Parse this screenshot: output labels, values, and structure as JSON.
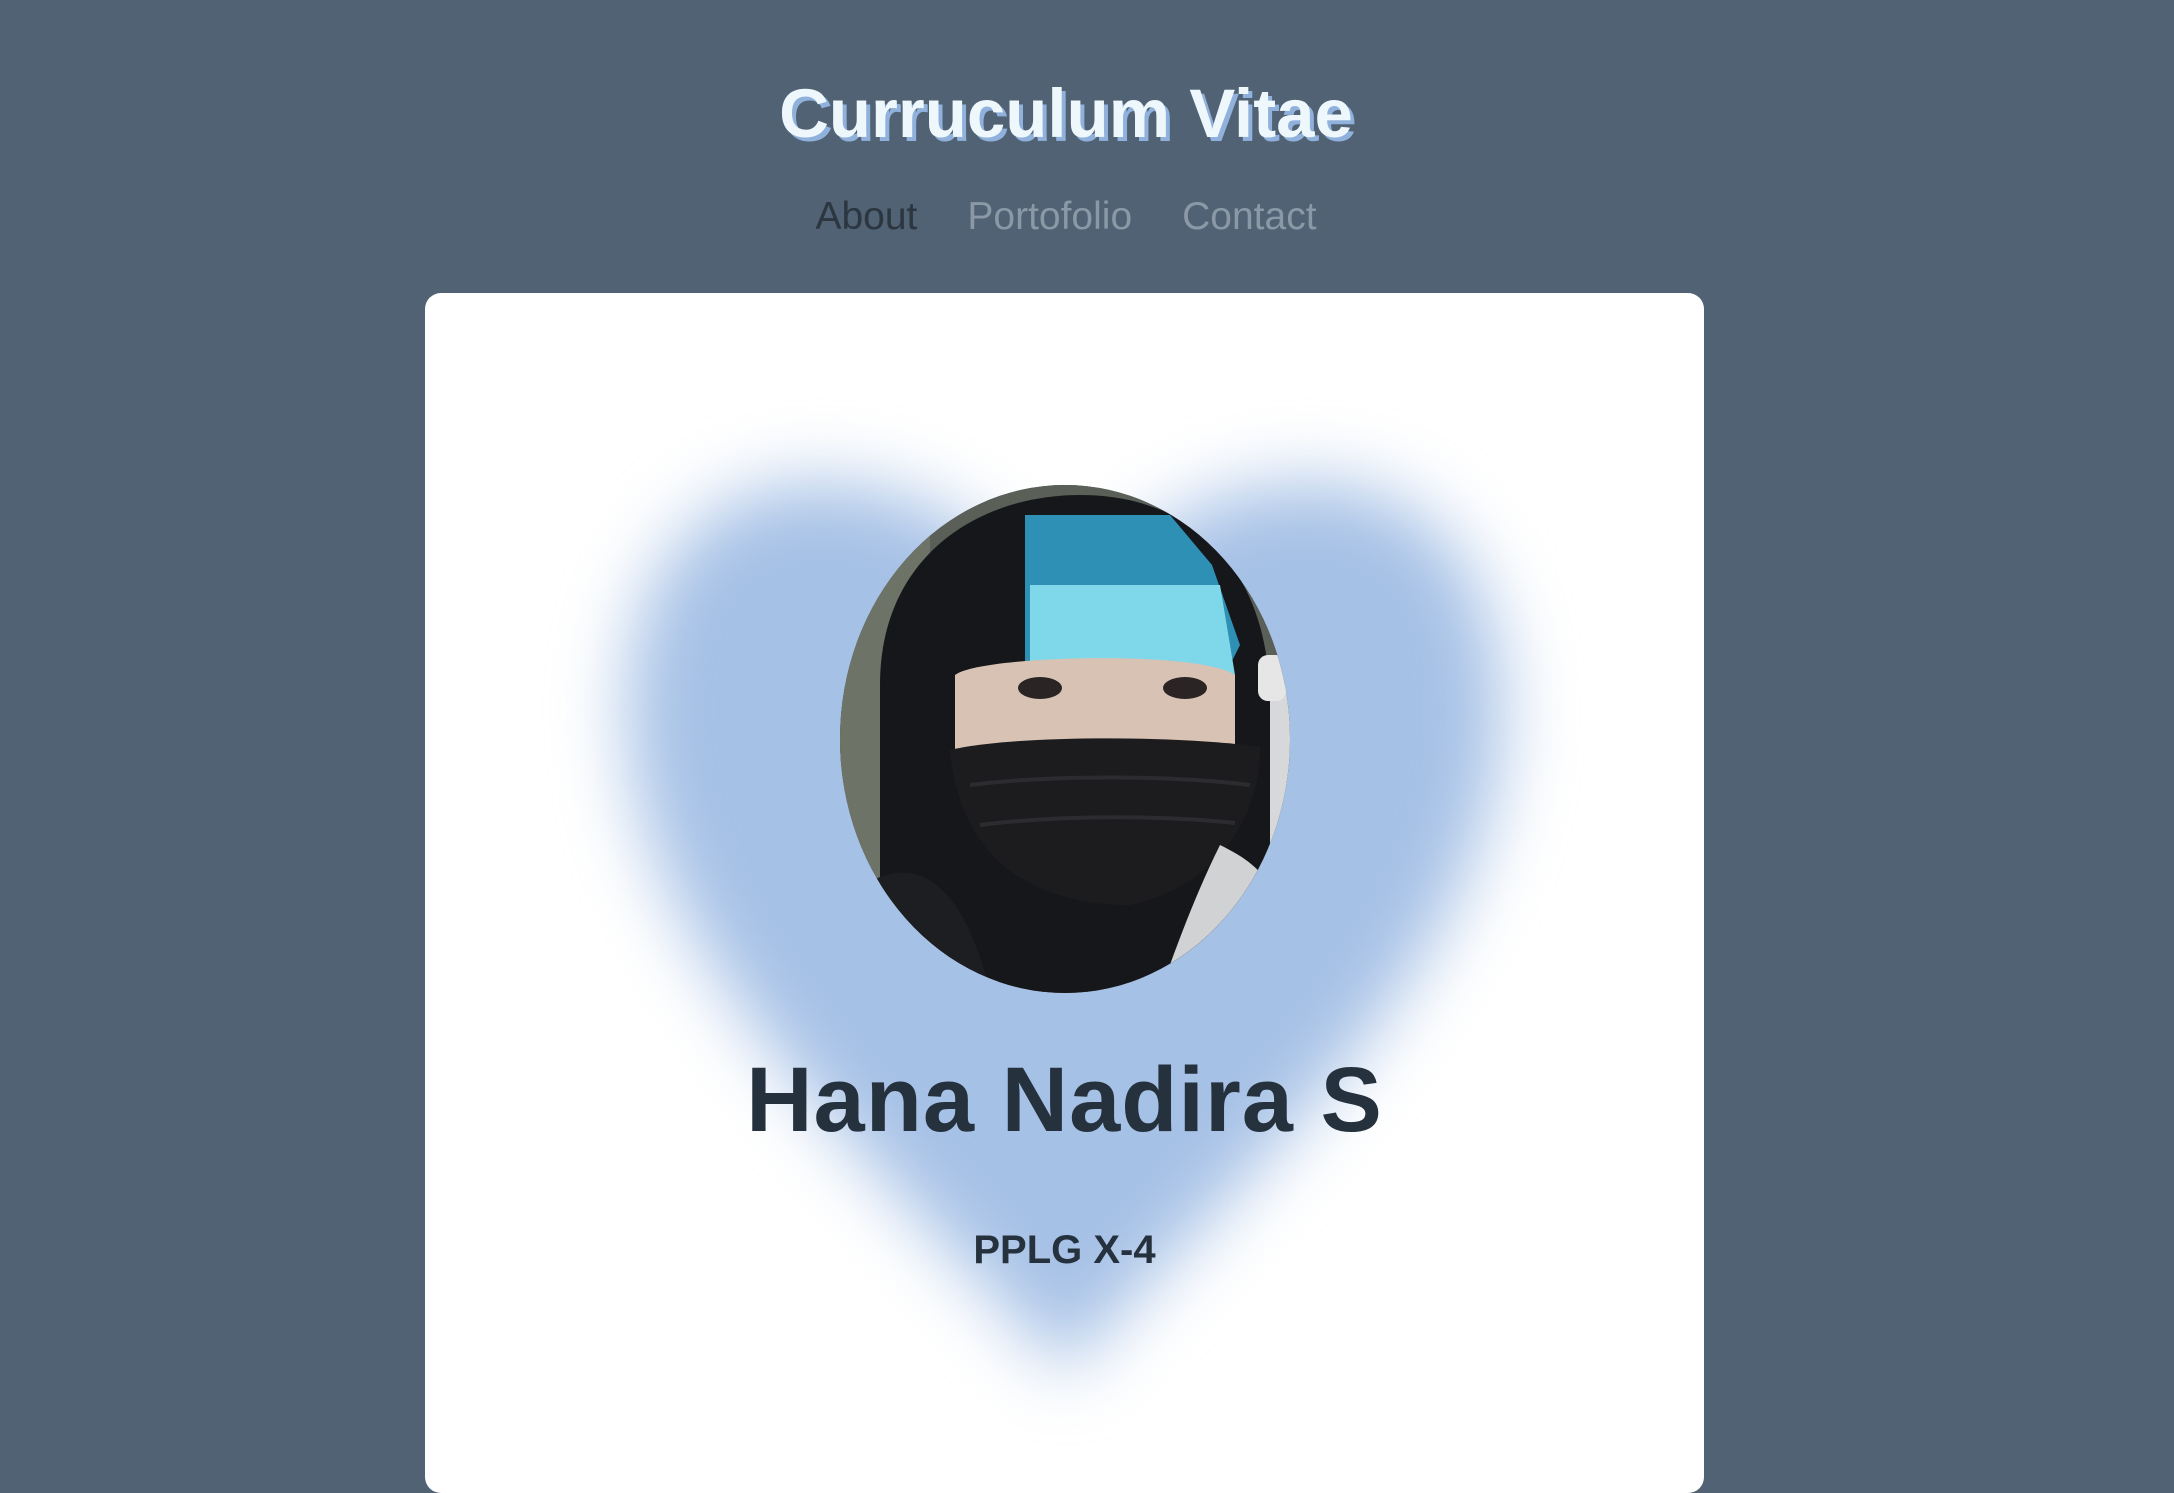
{
  "header": {
    "title": "Curruculum Vitae"
  },
  "nav": {
    "items": [
      {
        "label": "About",
        "active": true
      },
      {
        "label": "Portofolio",
        "active": false
      },
      {
        "label": "Contact",
        "active": false
      }
    ]
  },
  "profile": {
    "name": "Hana Nadira S",
    "class": "PPLG X-4",
    "photo_icon": "profile-photo"
  },
  "colors": {
    "background": "#506273",
    "card": "#ffffff",
    "heart_glow": "#9dbbe2",
    "title_text": "#eef7fb",
    "title_shadow": "#8fb1dc",
    "nav_active": "#2b3641",
    "nav_inactive": "#8b98a5",
    "name_text": "#25313d"
  }
}
